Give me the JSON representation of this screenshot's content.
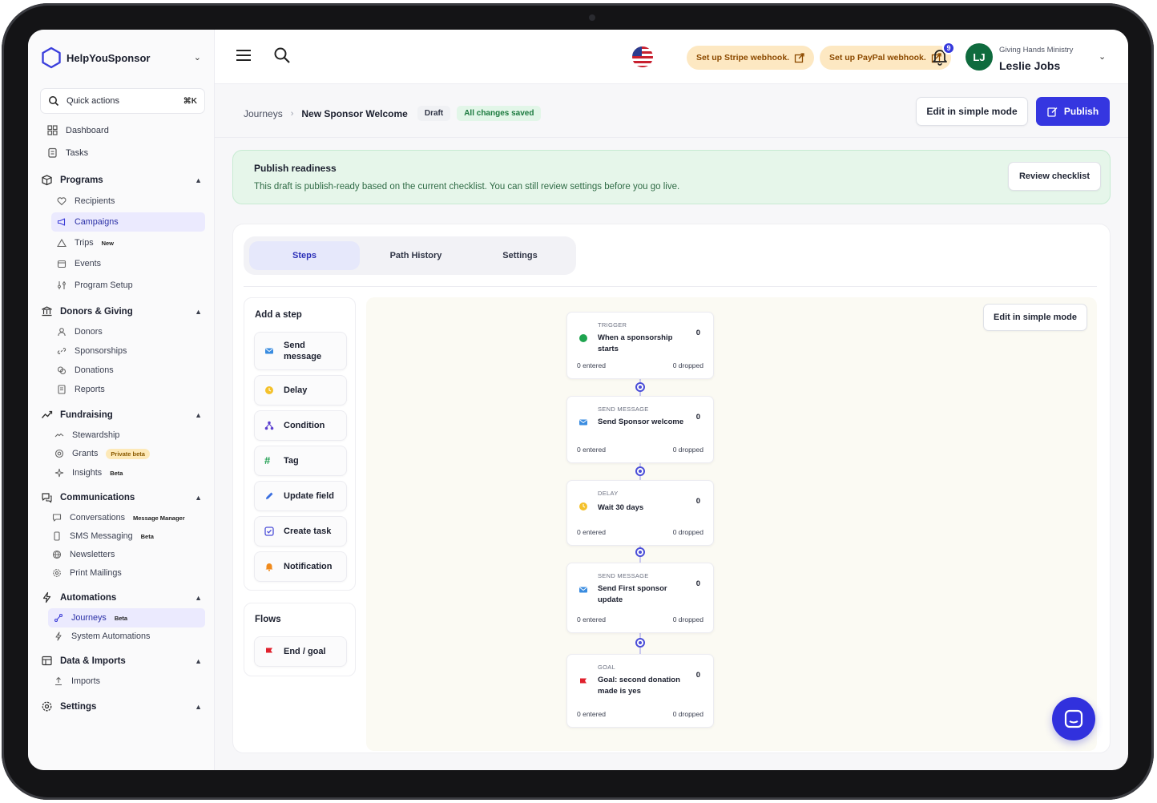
{
  "brand": {
    "name": "HelpYouSponsor"
  },
  "quick_actions": {
    "label": "Quick actions",
    "shortcut": "⌘K"
  },
  "nav_top": [
    {
      "label": "Dashboard",
      "icon": "dashboard-icon"
    },
    {
      "label": "Tasks",
      "icon": "tasks-icon"
    }
  ],
  "sections": {
    "programs": {
      "label": "Programs",
      "items": [
        "Recipients",
        "Campaigns",
        "Trips",
        "Events",
        "Program Setup"
      ],
      "trips_badge": "New"
    },
    "donors": {
      "label": "Donors & Giving",
      "items": [
        "Donors",
        "Sponsorships",
        "Donations",
        "Reports"
      ]
    },
    "fundraising": {
      "label": "Fundraising",
      "items": [
        "Stewardship",
        "Grants",
        "Insights"
      ],
      "grants_badge": "Private beta",
      "insights_badge": "Beta"
    },
    "communications": {
      "label": "Communications",
      "items": [
        "Conversations",
        "SMS Messaging",
        "Newsletters",
        "Print Mailings"
      ],
      "conversations_badge": "Message Manager",
      "sms_badge": "Beta"
    },
    "automations": {
      "label": "Automations",
      "items": [
        "Journeys",
        "System Automations"
      ],
      "journeys_badge": "Beta"
    },
    "data": {
      "label": "Data & Imports",
      "items": [
        "Imports"
      ]
    },
    "settings": {
      "label": "Settings"
    }
  },
  "topbar": {
    "stripe_label": "Set up Stripe webhook.",
    "paypal_label": "Set up PayPal webhook.",
    "notifications_count": "9",
    "avatar_initials": "LJ",
    "org_name": "Giving Hands Ministry",
    "user_name": "Leslie Jobs"
  },
  "header": {
    "crumb_parent": "Journeys",
    "crumb_current": "New Sponsor Welcome",
    "status": "Draft",
    "save_state": "All changes saved",
    "simple_mode_label": "Edit in simple mode",
    "publish_label": "Publish"
  },
  "readiness": {
    "title": "Publish readiness",
    "text": "This draft is publish-ready based on the current checklist. You can still review settings before you go live.",
    "button": "Review checklist"
  },
  "tabs": [
    "Steps",
    "Path History",
    "Settings"
  ],
  "add_step": {
    "title": "Add a step",
    "items": [
      "Send message",
      "Delay",
      "Condition",
      "Tag",
      "Update field",
      "Create task",
      "Notification"
    ]
  },
  "flows": {
    "title": "Flows",
    "items": [
      "End / goal"
    ]
  },
  "canvas": {
    "simple_mode_label": "Edit in simple mode"
  },
  "nodes": [
    {
      "kind": "TRIGGER",
      "title": "When a sponsorship starts",
      "count": "0",
      "entered": "0 entered",
      "dropped": "0 dropped"
    },
    {
      "kind": "SEND MESSAGE",
      "title": "Send Sponsor welcome",
      "count": "0",
      "entered": "0 entered",
      "dropped": "0 dropped"
    },
    {
      "kind": "DELAY",
      "title": "Wait 30 days",
      "count": "0",
      "entered": "0 entered",
      "dropped": "0 dropped"
    },
    {
      "kind": "SEND MESSAGE",
      "title": "Send First sponsor update",
      "count": "0",
      "entered": "0 entered",
      "dropped": "0 dropped"
    },
    {
      "kind": "GOAL",
      "title": "Goal: second donation made is yes",
      "count": "0",
      "entered": "0 entered",
      "dropped": "0 dropped"
    }
  ],
  "colors": {
    "primary": "#3536e0",
    "success_bg": "#e6f6ea",
    "warning_bg": "#fde8c2",
    "avatar": "#0f6b3e"
  }
}
